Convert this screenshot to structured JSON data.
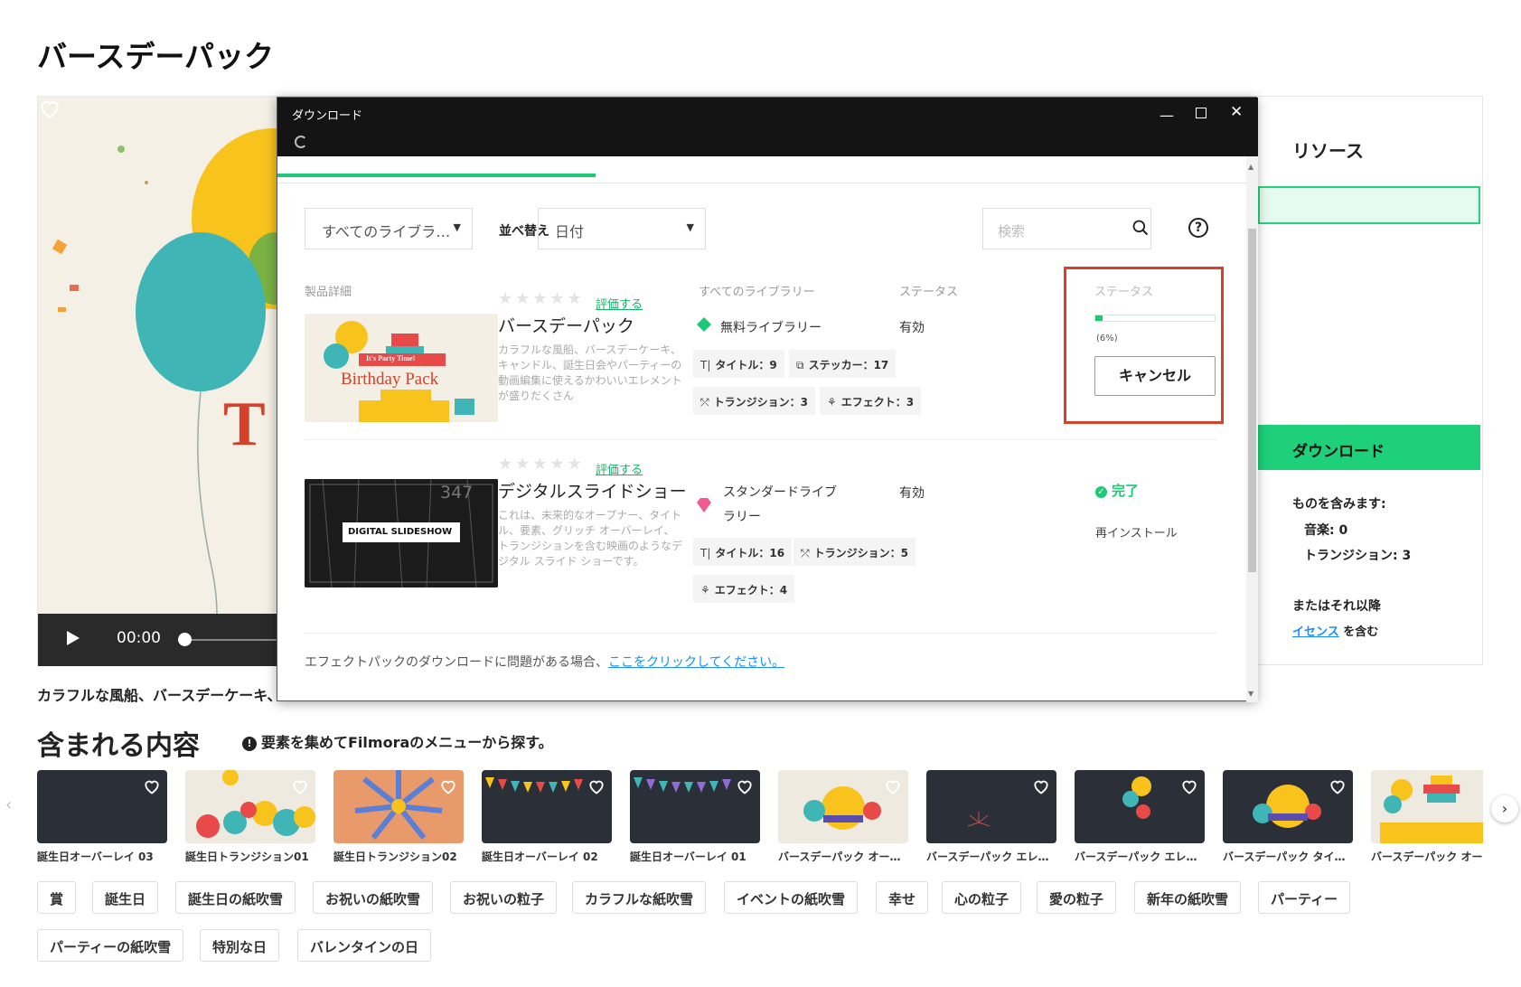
{
  "page": {
    "title": "バースデーパック",
    "hero_caption": "カラフルな風船、バースデーケーキ、",
    "video_time": "00:00"
  },
  "right_panel": {
    "title": "リソース",
    "download_label": "ダウンロード",
    "includes_label": "ものを含みます:",
    "music": "音楽: 0",
    "transitions": "トランジション: 3",
    "later": "またはそれ以降",
    "license_link": "イセンス",
    "license_suffix": "を含む"
  },
  "dialog": {
    "title": "ダウンロード",
    "window_buttons": {
      "minimize": "—",
      "close": "✕"
    },
    "library_select": "すべてのライブラ…",
    "sort_label": "並べ替え",
    "sort_select": "日付",
    "search_placeholder": "検索",
    "help": "?",
    "columns": {
      "product": "製品詳細",
      "library": "すべてのライブラリー",
      "status": "ステータス",
      "status2": "ステータス"
    },
    "products": [
      {
        "rate": "評価する",
        "name": "バースデーパック",
        "thumb_text": "Birthday Pack",
        "thumb_banner": "It's Party Time!",
        "desc": "カラフルな風船、バースデーケーキ、キャンドル、誕生日会やパーティーの動画編集に使えるかわいいエレメントが盛りだくさん",
        "library": "無料ライブラリー",
        "status": "有効",
        "chips": [
          "タイトル：9",
          "ステッカー：17",
          "トランジション：3",
          "エフェクト：3"
        ]
      },
      {
        "rate": "評価する",
        "name": "デジタルスライドショー",
        "thumb_text": "DIGITAL SLIDESHOW",
        "thumb_number": "347",
        "desc": "これは、未来的なオープナー、タイトル、要素、グリッチ オーバーレイ、トランジションを含む映画のようなデジタル スライド ショーです。",
        "library_line1": "スタンダードライブ",
        "library_line2": "ラリー",
        "status": "有効",
        "chips": [
          "タイトル：16",
          "トランジション：5",
          "エフェクト：4"
        ],
        "done": "完了",
        "reinstall": "再インストール"
      }
    ],
    "progress": {
      "percent": 6,
      "label": "(6%)"
    },
    "cancel_label": "キャンセル",
    "footer_text": "エフェクトパックのダウンロードに問題がある場合、",
    "footer_link": "ここをクリックしてください。"
  },
  "contents": {
    "title": "含まれる内容",
    "note": "要素を集めてFilmoraのメニューから探す。",
    "items": [
      "誕生日オーバーレイ 03",
      "誕生日トランジション01",
      "誕生日トランジション02",
      "誕生日オーバーレイ 02",
      "誕生日オーバーレイ 01",
      "バースデーパック オー…",
      "バースデーパック エレ…",
      "バースデーパック エレ…",
      "バースデーパック タイ…",
      "バースデーパック オー…"
    ]
  },
  "tags": [
    "賞",
    "誕生日",
    "誕生日の紙吹雪",
    "お祝いの紙吹雪",
    "お祝いの粒子",
    "カラフルな紙吹雪",
    "イベントの紙吹雪",
    "幸せ",
    "心の粒子",
    "愛の粒子",
    "新年の紙吹雪",
    "パーティー",
    "パーティーの紙吹雪",
    "特別な日",
    "バレンタインの日"
  ],
  "colors": {
    "accent": "#1ec878",
    "highlight": "#d6412c",
    "link": "#1a8cff"
  }
}
